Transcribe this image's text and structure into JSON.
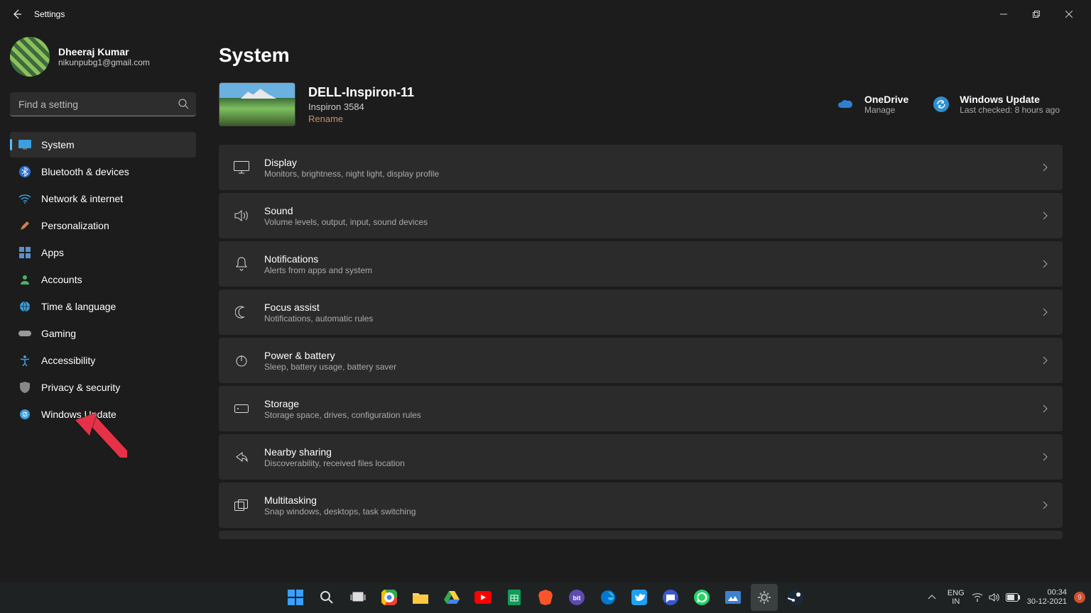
{
  "window": {
    "title": "Settings"
  },
  "profile": {
    "name": "Dheeraj Kumar",
    "email": "nikunpubg1@gmail.com"
  },
  "search": {
    "placeholder": "Find a setting"
  },
  "sidebar": {
    "items": [
      {
        "label": "System"
      },
      {
        "label": "Bluetooth & devices"
      },
      {
        "label": "Network & internet"
      },
      {
        "label": "Personalization"
      },
      {
        "label": "Apps"
      },
      {
        "label": "Accounts"
      },
      {
        "label": "Time & language"
      },
      {
        "label": "Gaming"
      },
      {
        "label": "Accessibility"
      },
      {
        "label": "Privacy & security"
      },
      {
        "label": "Windows Update"
      }
    ]
  },
  "page": {
    "title": "System"
  },
  "device": {
    "name": "DELL-Inspiron-11",
    "model": "Inspiron 3584",
    "rename": "Rename"
  },
  "quick": {
    "onedrive": {
      "title": "OneDrive",
      "sub": "Manage"
    },
    "update": {
      "title": "Windows Update",
      "sub": "Last checked: 8 hours ago"
    }
  },
  "settings": [
    {
      "title": "Display",
      "sub": "Monitors, brightness, night light, display profile"
    },
    {
      "title": "Sound",
      "sub": "Volume levels, output, input, sound devices"
    },
    {
      "title": "Notifications",
      "sub": "Alerts from apps and system"
    },
    {
      "title": "Focus assist",
      "sub": "Notifications, automatic rules"
    },
    {
      "title": "Power & battery",
      "sub": "Sleep, battery usage, battery saver"
    },
    {
      "title": "Storage",
      "sub": "Storage space, drives, configuration rules"
    },
    {
      "title": "Nearby sharing",
      "sub": "Discoverability, received files location"
    },
    {
      "title": "Multitasking",
      "sub": "Snap windows, desktops, task switching"
    }
  ],
  "taskbar": {
    "lang1": "ENG",
    "lang2": "IN",
    "time": "00:34",
    "date": "30-12-2021",
    "badge": "9"
  }
}
